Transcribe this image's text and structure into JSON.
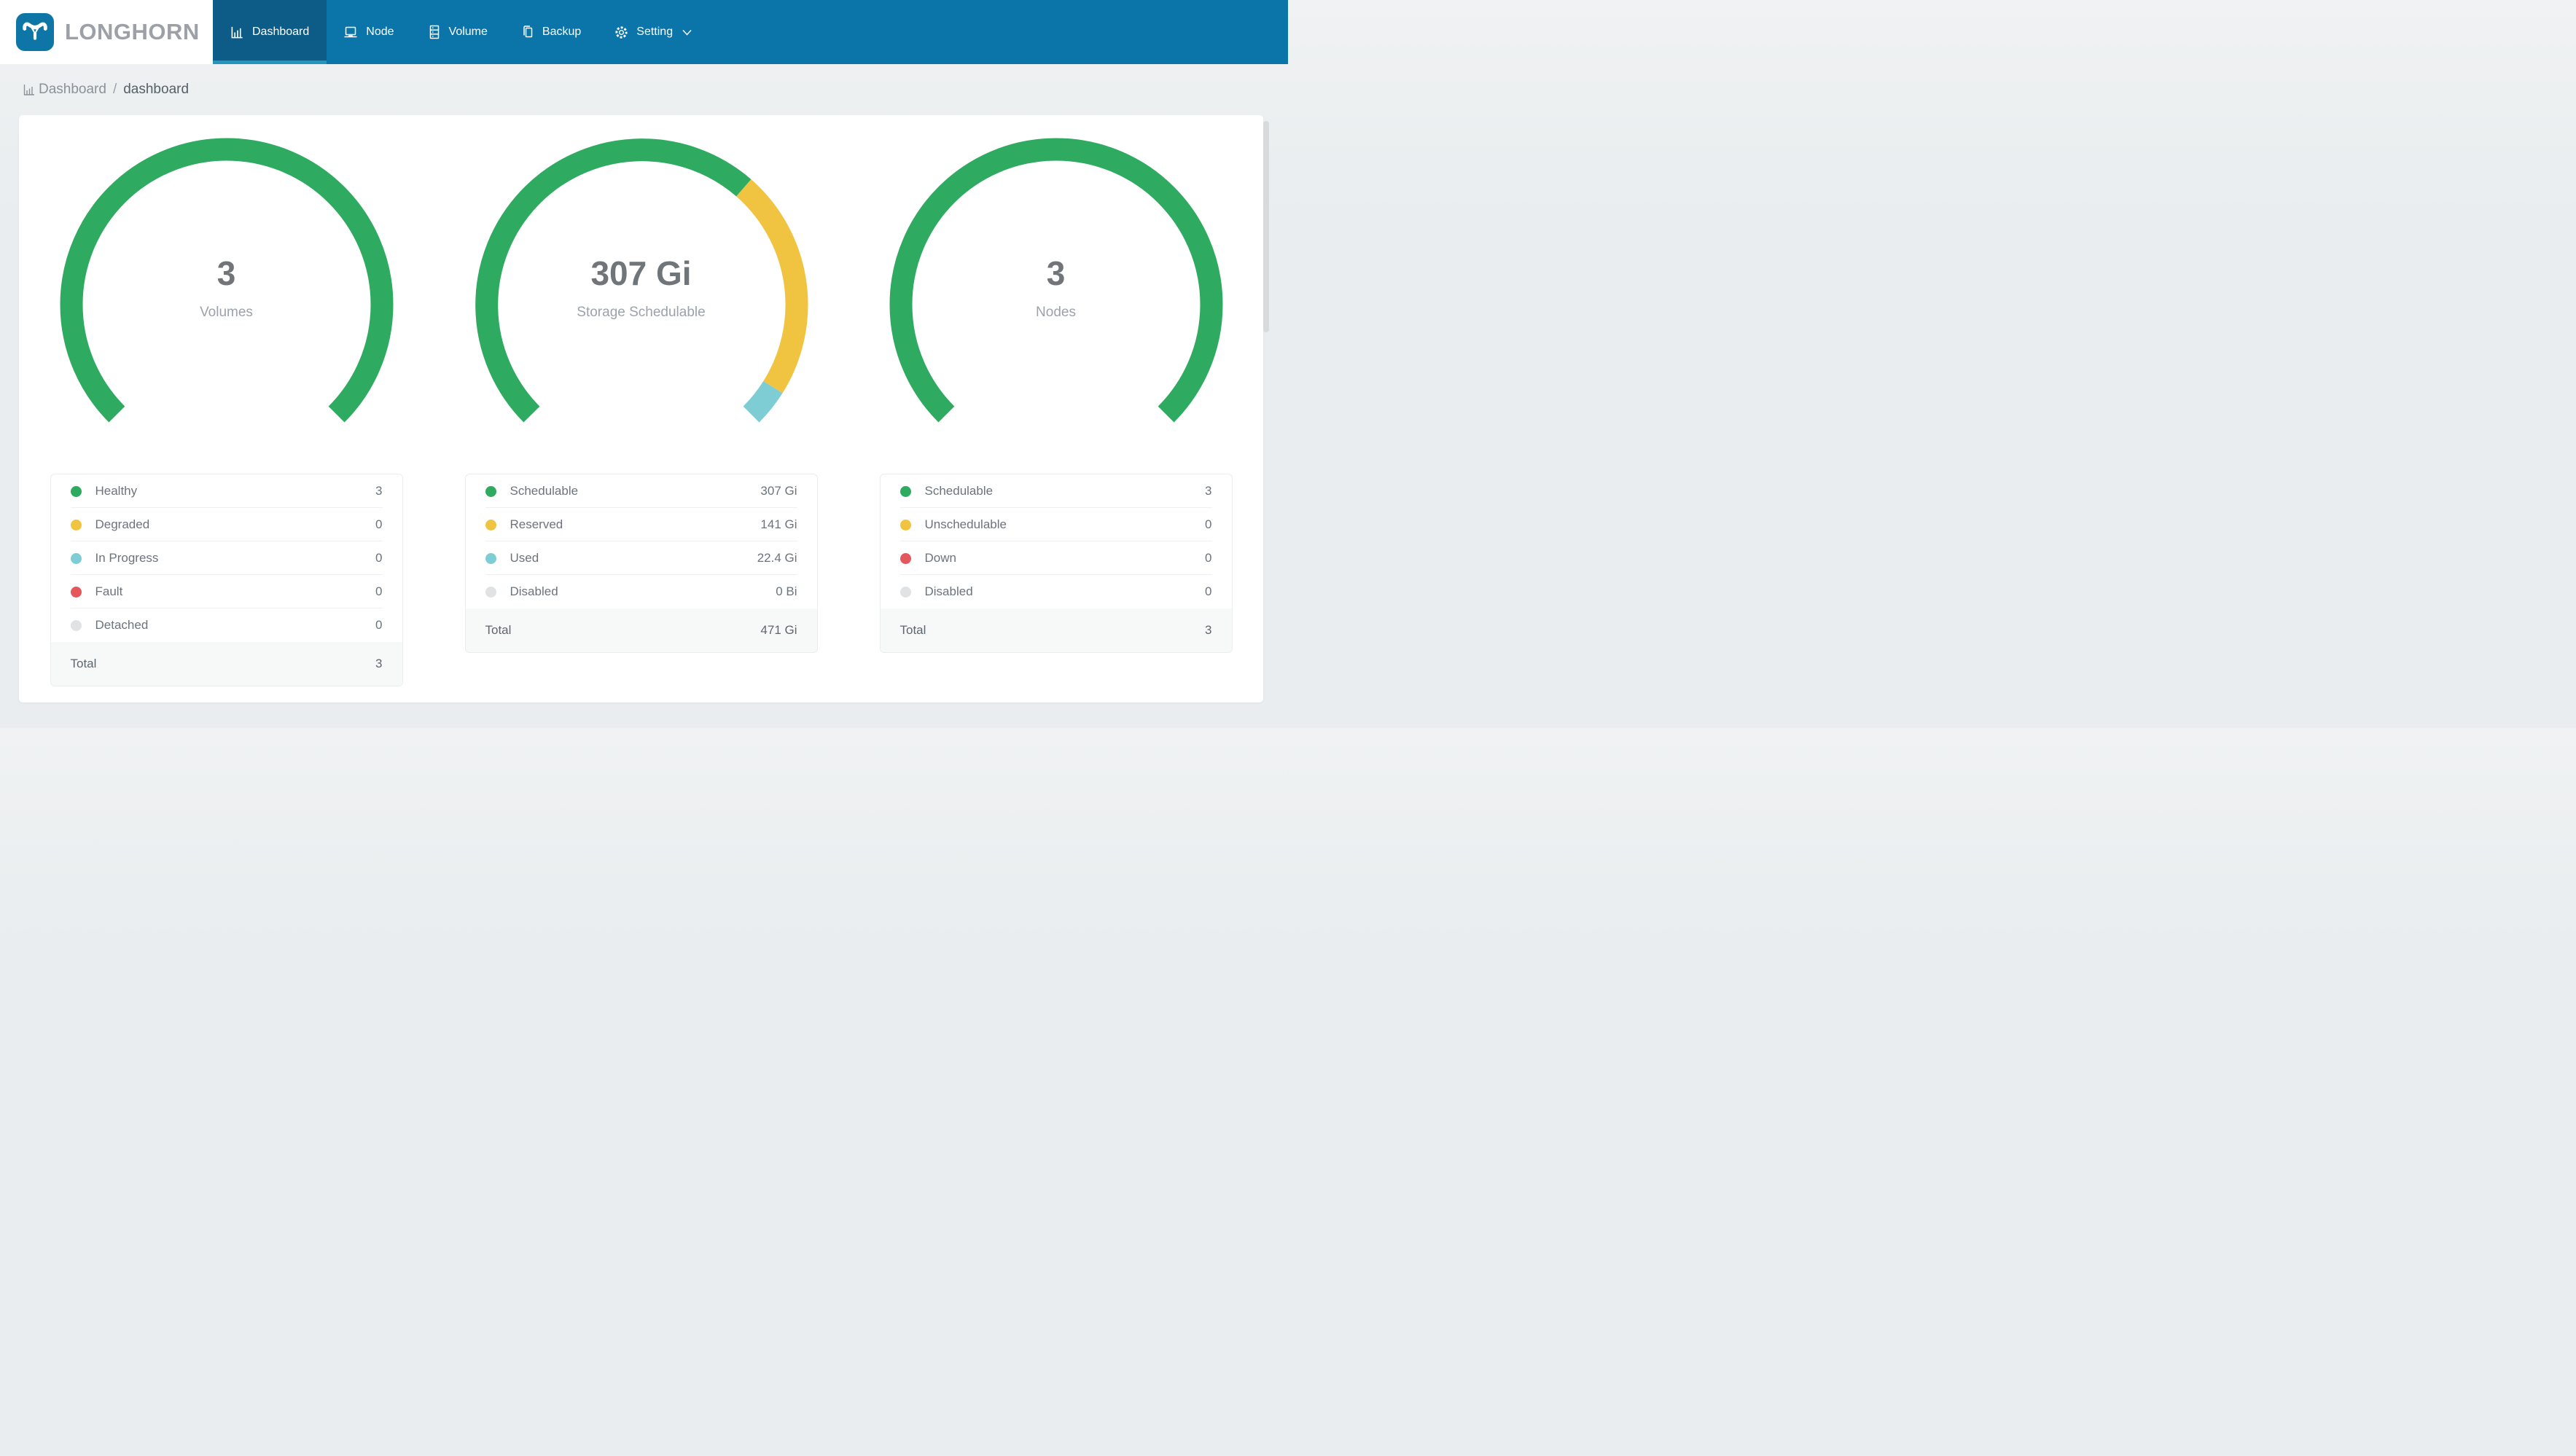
{
  "brand": {
    "name": "LONGHORN",
    "logo_icon": "longhorn-bull-icon",
    "logo_color": "#0e76a6"
  },
  "navbar": {
    "background": "#0b74a8",
    "active_background": "#0d5c87",
    "active_underline_color": "#2496bb",
    "items": [
      {
        "label": "Dashboard",
        "icon": "bar-chart-icon",
        "active": true
      },
      {
        "label": "Node",
        "icon": "laptop-icon",
        "active": false
      },
      {
        "label": "Volume",
        "icon": "server-rack-icon",
        "active": false
      },
      {
        "label": "Backup",
        "icon": "copy-icon",
        "active": false
      },
      {
        "label": "Setting",
        "icon": "gear-icon",
        "active": false,
        "has_dropdown": true,
        "dropdown_icon": "chevron-down-icon"
      }
    ]
  },
  "breadcrumb": {
    "icon": "bar-chart-icon",
    "root": "Dashboard",
    "separator": "/",
    "current": "dashboard"
  },
  "chart_data": [
    {
      "type": "donut",
      "center_value": "3",
      "center_label": "Volumes",
      "arc": {
        "start_deg": 135,
        "span_deg": 270,
        "direction": "clockwise",
        "stroke_width": 31,
        "radius": 213
      },
      "segments": [
        {
          "label": "Healthy",
          "value": 3,
          "display": "3",
          "color": "#2faa61"
        },
        {
          "label": "Degraded",
          "value": 0,
          "display": "0",
          "color": "#f0c440"
        },
        {
          "label": "In Progress",
          "value": 0,
          "display": "0",
          "color": "#7ecdd5"
        },
        {
          "label": "Fault",
          "value": 0,
          "display": "0",
          "color": "#e4575c"
        },
        {
          "label": "Detached",
          "value": 0,
          "display": "0",
          "color": "#e0e2e4"
        }
      ],
      "total": {
        "label": "Total",
        "value": 3,
        "display": "3"
      }
    },
    {
      "type": "donut",
      "center_value": "307 Gi",
      "center_label": "Storage Schedulable",
      "arc": {
        "start_deg": 135,
        "span_deg": 270,
        "direction": "clockwise",
        "stroke_width": 31,
        "radius": 213
      },
      "segments": [
        {
          "label": "Schedulable",
          "value": 307,
          "display": "307 Gi",
          "color": "#2faa61"
        },
        {
          "label": "Reserved",
          "value": 141,
          "display": "141 Gi",
          "color": "#f0c440"
        },
        {
          "label": "Used",
          "value": 22.4,
          "display": "22.4 Gi",
          "color": "#7ecdd5"
        },
        {
          "label": "Disabled",
          "value": 0,
          "display": "0 Bi",
          "color": "#e0e2e4"
        }
      ],
      "total": {
        "label": "Total",
        "value": 471,
        "display": "471 Gi"
      }
    },
    {
      "type": "donut",
      "center_value": "3",
      "center_label": "Nodes",
      "arc": {
        "start_deg": 135,
        "span_deg": 270,
        "direction": "clockwise",
        "stroke_width": 31,
        "radius": 213
      },
      "segments": [
        {
          "label": "Schedulable",
          "value": 3,
          "display": "3",
          "color": "#2faa61"
        },
        {
          "label": "Unschedulable",
          "value": 0,
          "display": "0",
          "color": "#f0c440"
        },
        {
          "label": "Down",
          "value": 0,
          "display": "0",
          "color": "#e4575c"
        },
        {
          "label": "Disabled",
          "value": 0,
          "display": "0",
          "color": "#e0e2e4"
        }
      ],
      "total": {
        "label": "Total",
        "value": 3,
        "display": "3"
      }
    }
  ]
}
